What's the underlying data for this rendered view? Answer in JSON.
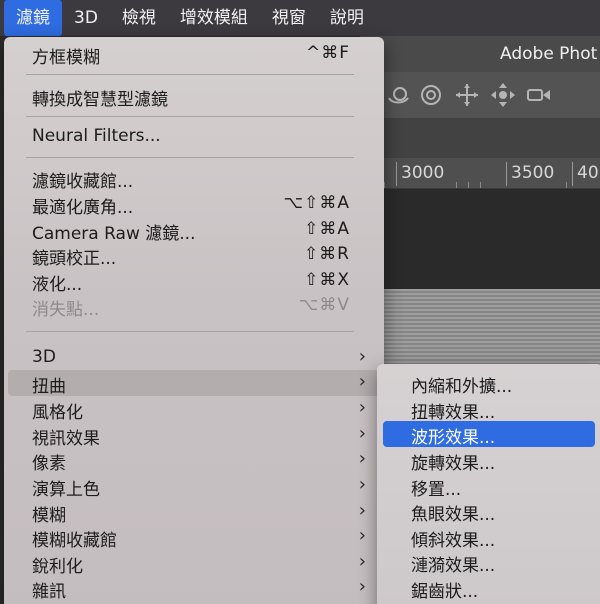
{
  "menubar": {
    "items": [
      {
        "label": "濾鏡",
        "active": true
      },
      {
        "label": "3D"
      },
      {
        "label": "檢視"
      },
      {
        "label": "增效模組"
      },
      {
        "label": "視窗"
      },
      {
        "label": "說明"
      }
    ]
  },
  "app": {
    "title": "Adobe Phot",
    "ruler_labels": [
      "3000",
      "3500",
      "40"
    ]
  },
  "filter_menu": {
    "items": [
      {
        "label": "方框模糊",
        "shortcut": "^⌘F"
      },
      {
        "label": "轉換成智慧型濾鏡"
      },
      {
        "label": "Neural Filters..."
      },
      {
        "label": "濾鏡收藏館..."
      },
      {
        "label": "最適化廣角...",
        "shortcut": "⌥⇧⌘A"
      },
      {
        "label": "Camera Raw 濾鏡...",
        "shortcut": "⇧⌘A"
      },
      {
        "label": "鏡頭校正...",
        "shortcut": "⇧⌘R"
      },
      {
        "label": "液化...",
        "shortcut": "⇧⌘X"
      },
      {
        "label": "消失點...",
        "shortcut": "⌥⌘V"
      },
      {
        "label": "3D",
        "submenu": true
      },
      {
        "label": "扭曲",
        "submenu": true
      },
      {
        "label": "風格化",
        "submenu": true
      },
      {
        "label": "視訊效果",
        "submenu": true
      },
      {
        "label": "像素",
        "submenu": true
      },
      {
        "label": "演算上色",
        "submenu": true
      },
      {
        "label": "模糊",
        "submenu": true
      },
      {
        "label": "模糊收藏館",
        "submenu": true
      },
      {
        "label": "銳利化",
        "submenu": true
      },
      {
        "label": "雜訊",
        "submenu": true
      }
    ],
    "chevron": "›"
  },
  "distort_submenu": {
    "items": [
      {
        "label": "內縮和外擴..."
      },
      {
        "label": "扭轉效果..."
      },
      {
        "label": "波形效果..."
      },
      {
        "label": "旋轉效果..."
      },
      {
        "label": "移置..."
      },
      {
        "label": "魚眼效果..."
      },
      {
        "label": "傾斜效果..."
      },
      {
        "label": "漣漪效果..."
      },
      {
        "label": "鋸齒狀..."
      }
    ]
  },
  "colors": {
    "accent": "#2f6ce1",
    "menubar_bg": "#3c3a3e"
  }
}
